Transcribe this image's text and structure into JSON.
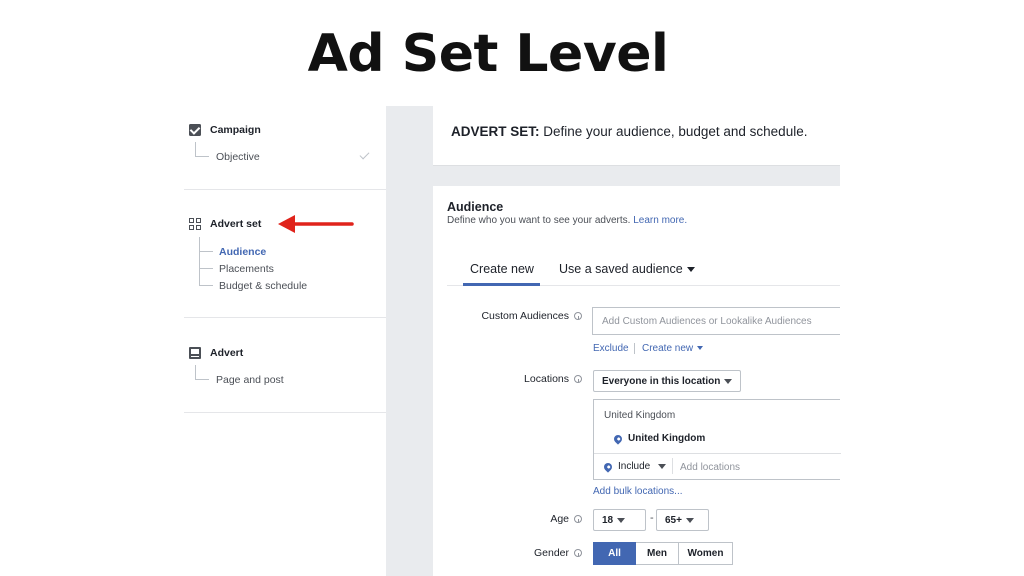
{
  "headline": "Ad Set Level",
  "sidebar": {
    "campaign": {
      "title": "Campaign",
      "items": [
        {
          "label": "Objective"
        }
      ]
    },
    "advert_set": {
      "title": "Advert set",
      "items": [
        {
          "label": "Audience"
        },
        {
          "label": "Placements"
        },
        {
          "label": "Budget & schedule"
        }
      ]
    },
    "advert": {
      "title": "Advert",
      "items": [
        {
          "label": "Page and post"
        }
      ]
    }
  },
  "header": {
    "title_bold": "ADVERT SET:",
    "title_rest": " Define your audience, budget and schedule."
  },
  "audience": {
    "title": "Audience",
    "description": "Define who you want to see your adverts. ",
    "learn_more": "Learn more.",
    "tabs": [
      {
        "label": "Create new"
      },
      {
        "label": "Use a saved audience"
      }
    ],
    "custom_audiences": {
      "label": "Custom Audiences",
      "placeholder": "Add Custom Audiences or Lookalike Audiences",
      "exclude": "Exclude",
      "create_new": "Create new"
    },
    "locations": {
      "label": "Locations",
      "dropdown": "Everyone in this location",
      "group_label": "United Kingdom",
      "selected": "United Kingdom",
      "include": "Include",
      "add_placeholder": "Add locations",
      "bulk_link": "Add bulk locations..."
    },
    "age": {
      "label": "Age",
      "min": "18",
      "separator": "-",
      "max": "65+"
    },
    "gender": {
      "label": "Gender",
      "options": [
        {
          "label": "All"
        },
        {
          "label": "Men"
        },
        {
          "label": "Women"
        }
      ],
      "selected": "All"
    }
  },
  "colors": {
    "accent": "#4267b2",
    "arrow": "#e0231b",
    "panel_bg": "#e9ebee"
  }
}
